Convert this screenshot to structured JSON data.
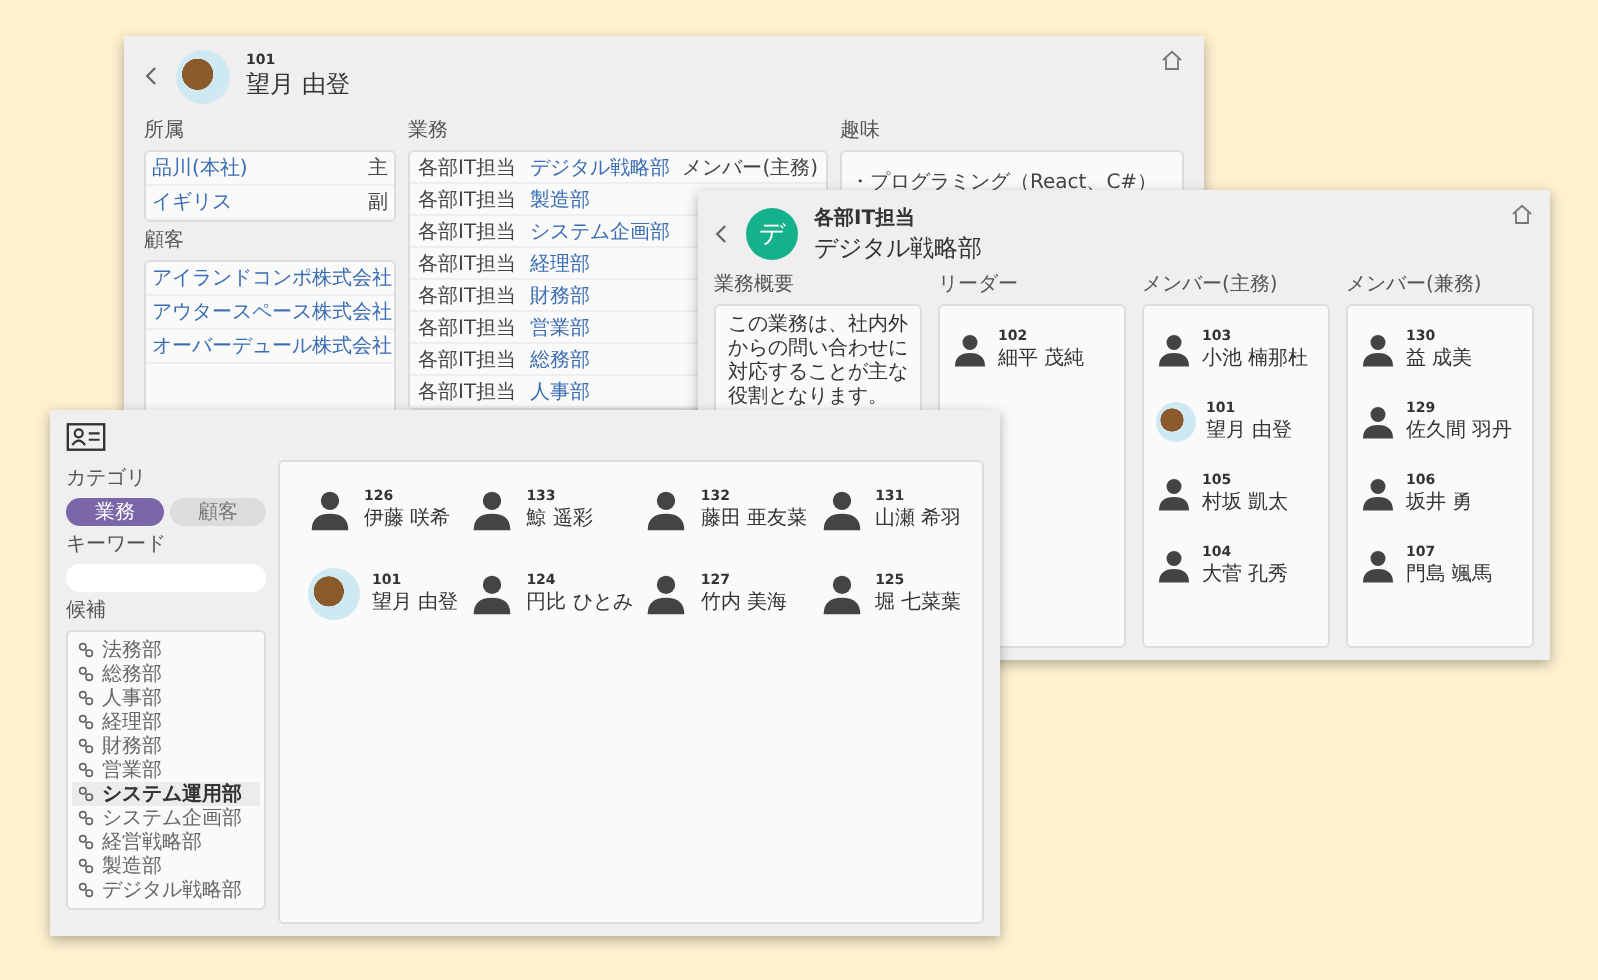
{
  "employee_window": {
    "employee_id": "101",
    "employee_name": "望月 由登",
    "avatar": {
      "kind": "photo"
    },
    "affiliation": {
      "label": "所属",
      "items": [
        {
          "name": "品川(本社)",
          "role": "主"
        },
        {
          "name": "イギリス",
          "role": "副"
        }
      ]
    },
    "customers": {
      "label": "顧客",
      "items": [
        "アイランドコンポ株式会社",
        "アウタースペース株式会社",
        "オーバーデュール株式会社"
      ]
    },
    "duties": {
      "label": "業務",
      "rows": [
        {
          "category": "各部IT担当",
          "department": "デジタル戦略部",
          "role": "メンバー(主務)"
        },
        {
          "category": "各部IT担当",
          "department": "製造部"
        },
        {
          "category": "各部IT担当",
          "department": "システム企画部"
        },
        {
          "category": "各部IT担当",
          "department": "経理部"
        },
        {
          "category": "各部IT担当",
          "department": "財務部"
        },
        {
          "category": "各部IT担当",
          "department": "営業部"
        },
        {
          "category": "各部IT担当",
          "department": "総務部"
        },
        {
          "category": "各部IT担当",
          "department": "人事部"
        }
      ]
    },
    "hobbies": {
      "label": "趣味",
      "items": [
        "・プログラミング（React、C#）"
      ]
    }
  },
  "department_window": {
    "subtitle": "各部IT担当",
    "title": "デジタル戦略部",
    "avatar_letter": "デ",
    "overview": {
      "label": "業務概要",
      "text": "この業務は、社内外からの問い合わせに対応することが主な役割となります。"
    },
    "member_columns": [
      {
        "label": "リーダー",
        "members": [
          {
            "id": "102",
            "name": "細平 茂純",
            "kind": "generic"
          }
        ]
      },
      {
        "label": "メンバー(主務)",
        "members": [
          {
            "id": "103",
            "name": "小池 楠那杜",
            "kind": "generic"
          },
          {
            "id": "101",
            "name": "望月 由登",
            "kind": "photo"
          },
          {
            "id": "105",
            "name": "村坂 凱太",
            "kind": "generic"
          },
          {
            "id": "104",
            "name": "大菅 孔秀",
            "kind": "generic"
          }
        ]
      },
      {
        "label": "メンバー(兼務)",
        "members": [
          {
            "id": "130",
            "name": "益 成美",
            "kind": "generic"
          },
          {
            "id": "129",
            "name": "佐久間 羽丹",
            "kind": "generic"
          },
          {
            "id": "106",
            "name": "坂井 勇",
            "kind": "generic"
          },
          {
            "id": "107",
            "name": "門島 颯馬",
            "kind": "generic"
          }
        ]
      }
    ]
  },
  "search_window": {
    "category_label": "カテゴリ",
    "categories": [
      {
        "label": "業務",
        "selected": true
      },
      {
        "label": "顧客",
        "selected": false
      }
    ],
    "keyword_label": "キーワード",
    "candidates_label": "候補",
    "candidates": [
      {
        "label": "法務部",
        "selected": false
      },
      {
        "label": "総務部",
        "selected": false
      },
      {
        "label": "人事部",
        "selected": false
      },
      {
        "label": "経理部",
        "selected": false
      },
      {
        "label": "財務部",
        "selected": false
      },
      {
        "label": "営業部",
        "selected": false
      },
      {
        "label": "システム運用部",
        "selected": true
      },
      {
        "label": "システム企画部",
        "selected": false
      },
      {
        "label": "経営戦略部",
        "selected": false
      },
      {
        "label": "製造部",
        "selected": false
      },
      {
        "label": "デジタル戦略部",
        "selected": false
      }
    ],
    "results": [
      {
        "id": "126",
        "name": "伊藤 咲希",
        "kind": "generic"
      },
      {
        "id": "133",
        "name": "鯨 遥彩",
        "kind": "generic"
      },
      {
        "id": "132",
        "name": "藤田 亜友菜",
        "kind": "generic"
      },
      {
        "id": "131",
        "name": "山瀬 希羽",
        "kind": "generic"
      },
      {
        "id": "101",
        "name": "望月 由登",
        "kind": "photo"
      },
      {
        "id": "124",
        "name": "円比 ひとみ",
        "kind": "generic"
      },
      {
        "id": "127",
        "name": "竹内 美海",
        "kind": "generic"
      },
      {
        "id": "125",
        "name": "堀 七菜葉",
        "kind": "generic"
      }
    ]
  }
}
